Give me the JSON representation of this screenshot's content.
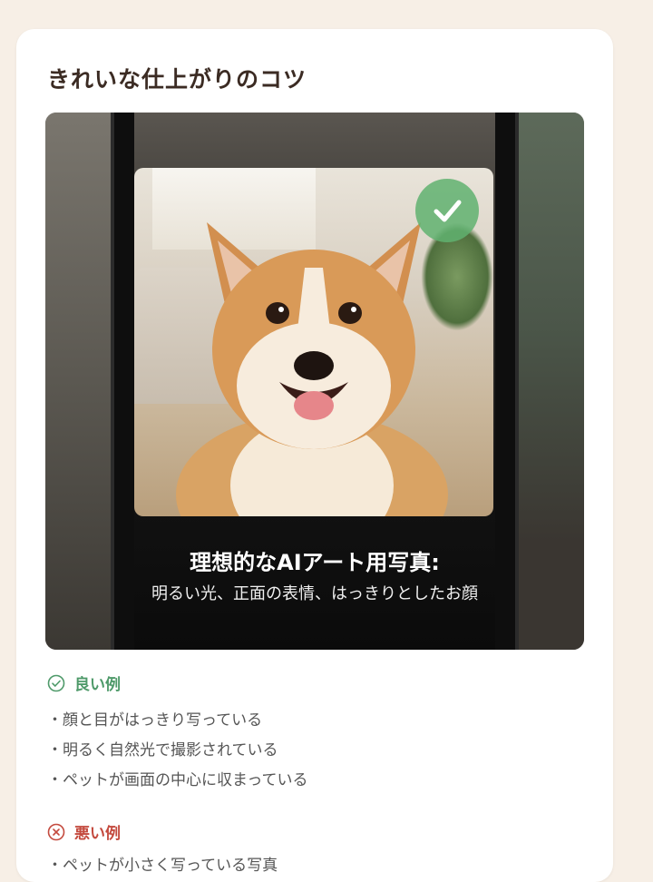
{
  "title": "きれいな仕上がりのコツ",
  "hero": {
    "photo_subject": "corgi-photo",
    "badge_icon": "check-icon",
    "caption_title": "理想的なAIアート用写真:",
    "caption_sub": "明るい光、正面の表情、はっきりとしたお顔"
  },
  "good": {
    "icon": "check-circle-icon",
    "label": "良い例",
    "color": "#4f9a6a",
    "items": [
      "・顔と目がはっきり写っている",
      "・明るく自然光で撮影されている",
      "・ペットが画面の中心に収まっている"
    ]
  },
  "bad": {
    "icon": "x-circle-icon",
    "label": "悪い例",
    "color": "#c44a3e",
    "items": [
      "・ペットが小さく写っている写真"
    ]
  }
}
